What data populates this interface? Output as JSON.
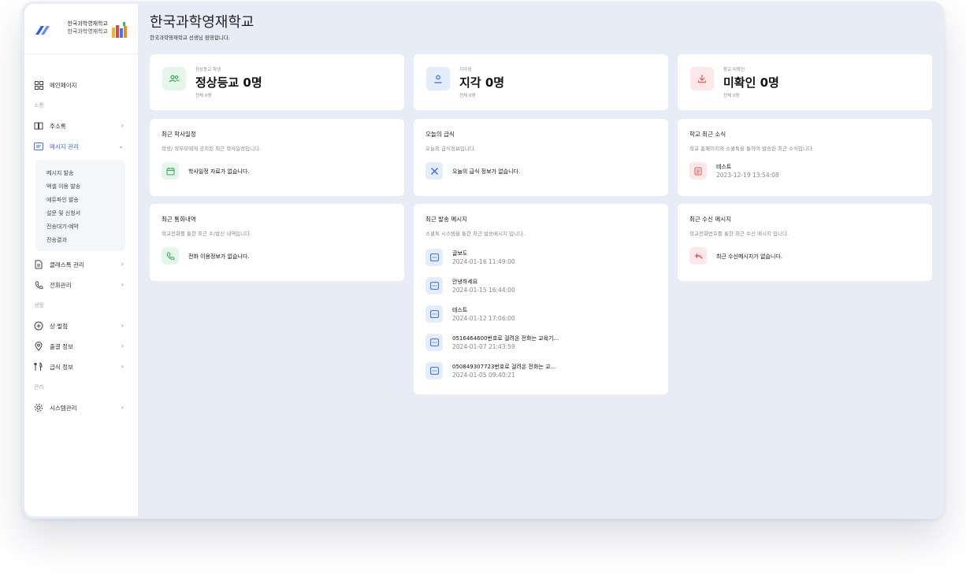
{
  "brand": {
    "name": "한국과학영재학교",
    "sub": "한국과학영재학교"
  },
  "header": {
    "title": "한국과학영재학교",
    "subtitle": "한국과학영재학교 선생님 환영합니다."
  },
  "sidebar": {
    "home": "메인페이지",
    "section_communication": "소통",
    "address_book": "주소록",
    "message_mgmt": "메시지 관리",
    "message_sub": [
      "메시지 발송",
      "엑셀 이용 발송",
      "에듀파인 발송",
      "설문 및 신청서",
      "전송대기·예약",
      "전송결과"
    ],
    "classtalk_mgmt": "클래스톡 관리",
    "phone_mgmt": "전화관리",
    "section_life": "생활",
    "points": "상·벌점",
    "attendance": "출결 정보",
    "meal": "급식 정보",
    "section_admin": "관리",
    "system_mgmt": "시스템관리"
  },
  "stats": [
    {
      "label": "정상등교 학생",
      "value": "정상등교 0명",
      "total": "전체 0명",
      "icon": "users-icon"
    },
    {
      "label": "지각생",
      "value": "지각 0명",
      "total": "전체 0명",
      "icon": "person-icon"
    },
    {
      "label": "등교 미확인",
      "value": "미확인 0명",
      "total": "전체 0명",
      "icon": "download-icon"
    }
  ],
  "schedule": {
    "title": "최근 학사일정",
    "desc": "학생/ 학부모에게 공지된 최근 학사일정입니다.",
    "empty": "학사일정 자료가 없습니다."
  },
  "meal_card": {
    "title": "오늘의 급식",
    "desc": "오늘의 급식정보입니다.",
    "empty": "오늘의 급식 정보가 없습니다."
  },
  "news": {
    "title": "학교 최근 소식",
    "desc": "학교 홈페이지와 스쿨톡을 통하여 발송된 최근 소식입니다.",
    "item_title": "테스트",
    "item_date": "2023-12-19 13:54:08"
  },
  "calls": {
    "title": "최근 통화내역",
    "desc": "학교전화를 통한 최근 수/발신 내역입니다.",
    "empty": "전화 이용정보가 없습니다."
  },
  "sent": {
    "title": "최근 발송 메시지",
    "desc": "스쿨톡 시스템을 통한 최근 발송메시지 입니다.",
    "items": [
      {
        "title": "글보도",
        "date": "2024-01-16 11:49:00"
      },
      {
        "title": "안녕하세요",
        "date": "2024-01-15 16:44:00"
      },
      {
        "title": "테스트",
        "date": "2024-01-12 17:06:00"
      },
      {
        "title": "0516464600번호로 걸려온 전화는 교육기...",
        "date": "2024-01-07 21:43:59"
      },
      {
        "title": "050849307723번호로 걸려온 전화는 교...",
        "date": "2024-01-05 09:40:21"
      }
    ]
  },
  "received": {
    "title": "최근 수신 메시지",
    "desc": "학교전화번호를 통한 최근 수신 메시지 입니다.",
    "empty": "최근 수신메시지가 없습니다."
  }
}
